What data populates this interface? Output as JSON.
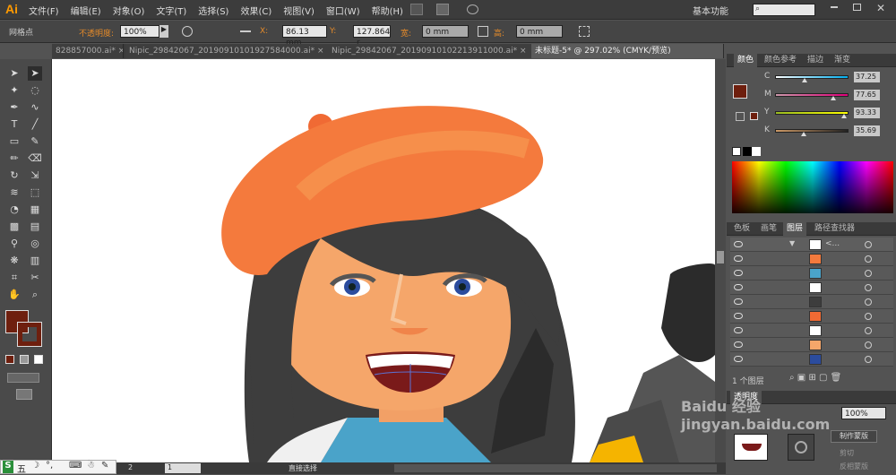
{
  "app": {
    "logo": "Ai",
    "workspace": "基本功能",
    "search_placeholder": ""
  },
  "menu": [
    "文件(F)",
    "编辑(E)",
    "对象(O)",
    "文字(T)",
    "选择(S)",
    "效果(C)",
    "视图(V)",
    "窗口(W)",
    "帮助(H)"
  ],
  "control": {
    "selection_label": "网格点",
    "opacity_label": "不透明度:",
    "opacity_value": "100%",
    "x_label": "X:",
    "x_value": "86.13 mm",
    "y_label": "Y:",
    "y_value": "127.864 r",
    "w_label": "宽:",
    "w_value": "0 mm",
    "h_label": "高:",
    "h_value": "0 mm"
  },
  "tabs": [
    {
      "label": "828857000.ai* ×",
      "active": false
    },
    {
      "label": "Nipic_29842067_20190910101927584000.ai* ×",
      "active": false
    },
    {
      "label": "Nipic_29842067_20190910102213911000.ai* ×",
      "active": false
    },
    {
      "label": "未标题-5* @ 297.02% (CMYK/预览)",
      "active": true
    }
  ],
  "color_panel": {
    "tabs": [
      "颜色",
      "颜色参考",
      "描边",
      "渐变"
    ],
    "channels": [
      {
        "name": "C",
        "value": "37.25",
        "pos": 0.37
      },
      {
        "name": "M",
        "value": "77.65",
        "pos": 0.78
      },
      {
        "name": "Y",
        "value": "93.33",
        "pos": 0.93
      },
      {
        "name": "K",
        "value": "35.69",
        "pos": 0.36
      }
    ],
    "fill_color": "#6e1f0e"
  },
  "layers_panel": {
    "tabs": [
      "色板",
      "画笔",
      "图层",
      "路径查找器"
    ],
    "layer_name": "<...",
    "rows": 9,
    "footer": "1 个图层"
  },
  "transparency_panel": {
    "tab": "透明度",
    "opacity": "100%",
    "make_mask": "制作蒙版",
    "clip": "剪切",
    "invert": "反相蒙版"
  },
  "status": {
    "zoom": "2",
    "page": "1",
    "tool": "直接选择"
  },
  "taskbar": {
    "ime": "五"
  },
  "watermark": "Baidu 经验 jingyan.baidu.com"
}
